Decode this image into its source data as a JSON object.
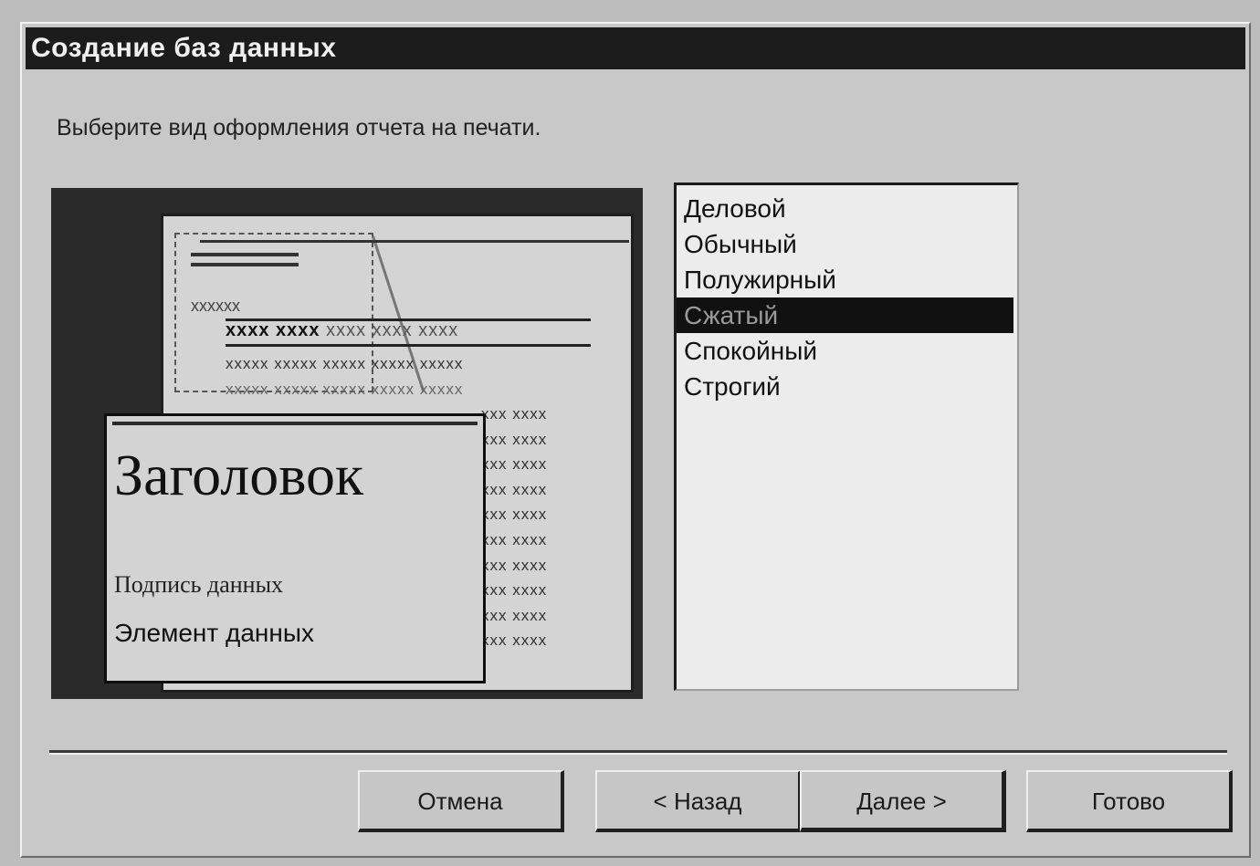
{
  "window": {
    "title": "Создание баз данных"
  },
  "prompt": "Выберите вид оформления отчета на печати.",
  "preview": {
    "small_label": "xxxxxx",
    "header_bold": "xxxx xxxx",
    "header_rest": "xxxx xxxx xxxx",
    "rows": [
      "xxxxx xxxxx xxxxx xxxxx xxxxx",
      "xxxxx xxxxx xxxxx xxxxx xxxxx"
    ],
    "right_rows": [
      "xxx xxxx",
      "xxx xxxx",
      "xxx xxxx",
      "xxx xxxx",
      "xxx xxxx",
      "xxx xxxx",
      "xxx xxxx",
      "xxx xxxx",
      "xxx xxxx",
      "xxx xxxx"
    ],
    "overlay_title": "Заголовок",
    "overlay_caption": "Подпись данных",
    "overlay_item": "Элемент данных"
  },
  "style_list": {
    "items": [
      "Деловой",
      "Обычный",
      "Полужирный",
      "Сжатый",
      "Спокойный",
      "Строгий"
    ],
    "selected_index": 3
  },
  "buttons": {
    "cancel": "Отмена",
    "back": "< Назад",
    "next": "Далее >",
    "finish": "Готово"
  }
}
